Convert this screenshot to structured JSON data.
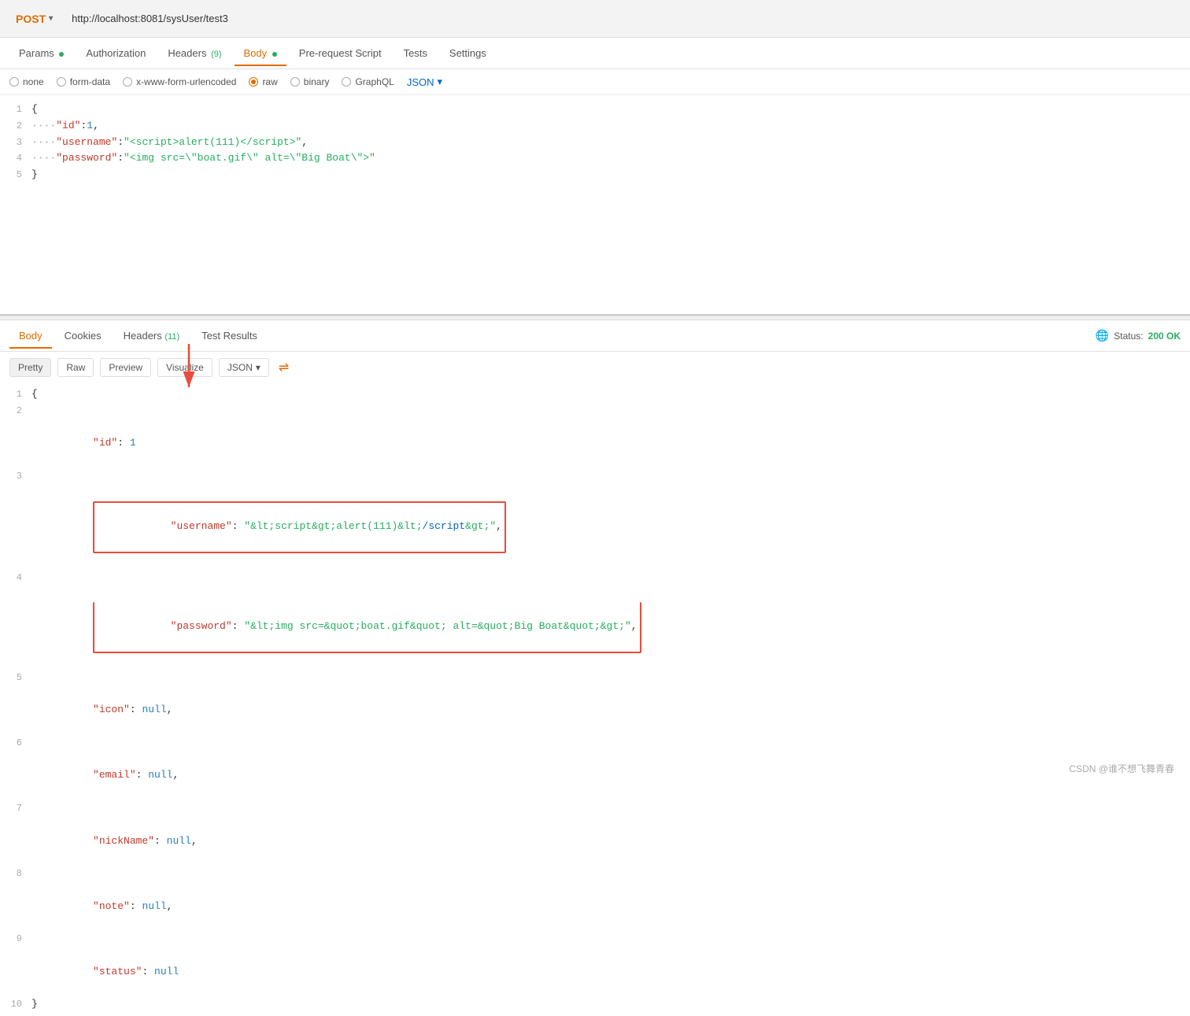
{
  "urlbar": {
    "method": "POST",
    "url": "http://localhost:8081/sysUser/test3",
    "chevron": "▾"
  },
  "tabs": [
    {
      "id": "params",
      "label": "Params",
      "dot": true,
      "active": false
    },
    {
      "id": "authorization",
      "label": "Authorization",
      "active": false
    },
    {
      "id": "headers",
      "label": "Headers",
      "badge": "(9)",
      "active": false
    },
    {
      "id": "body",
      "label": "Body",
      "dot": true,
      "active": true
    },
    {
      "id": "pre-request-script",
      "label": "Pre-request Script",
      "active": false
    },
    {
      "id": "tests",
      "label": "Tests",
      "active": false
    },
    {
      "id": "settings",
      "label": "Settings",
      "active": false
    }
  ],
  "body_types": [
    {
      "id": "none",
      "label": "none",
      "checked": false
    },
    {
      "id": "form-data",
      "label": "form-data",
      "checked": false
    },
    {
      "id": "x-www-form-urlencoded",
      "label": "x-www-form-urlencoded",
      "checked": false
    },
    {
      "id": "raw",
      "label": "raw",
      "checked": true
    },
    {
      "id": "binary",
      "label": "binary",
      "checked": false
    },
    {
      "id": "graphql",
      "label": "GraphQL",
      "checked": false
    }
  ],
  "json_dropdown": {
    "label": "JSON",
    "chevron": "▾"
  },
  "request_code": [
    {
      "num": "1",
      "content": "{"
    },
    {
      "num": "2",
      "content": "    \"id\":1,"
    },
    {
      "num": "3",
      "content": "    \"username\":\"<script>alert(111)<\\/script>\","
    },
    {
      "num": "4",
      "content": "    \"password\":\"<img src=\\\"boat.gif\\\" alt=\\\"Big Boat\\\">\""
    },
    {
      "num": "5",
      "content": "}"
    }
  ],
  "response": {
    "tabs": [
      {
        "id": "body",
        "label": "Body",
        "active": true
      },
      {
        "id": "cookies",
        "label": "Cookies",
        "active": false
      },
      {
        "id": "headers",
        "label": "Headers",
        "badge": "(11)",
        "active": false
      },
      {
        "id": "test-results",
        "label": "Test Results",
        "active": false
      }
    ],
    "status": "Status:",
    "status_code": "200 OK",
    "format_tabs": [
      "Pretty",
      "Raw",
      "Preview",
      "Visualize"
    ],
    "active_format": "Pretty",
    "format_dropdown": {
      "label": "JSON",
      "chevron": "▾"
    },
    "lines": [
      {
        "num": "1",
        "content": "{"
      },
      {
        "num": "2",
        "content": "    \"id\": 1"
      },
      {
        "num": "3",
        "content": "    \"username\": \"&amp;lt;script&amp;gt;alert(111)&amp;lt;/script&amp;gt;\",",
        "highlighted": true
      },
      {
        "num": "4",
        "content": "    \"password\": \"&amp;lt;img src=&amp;quot;boat.gif&amp;quot; alt=&amp;quot;Big Boat&amp;quot;&amp;gt;\",",
        "highlighted": true
      },
      {
        "num": "5",
        "content": "    \"icon\": null,"
      },
      {
        "num": "6",
        "content": "    \"email\": null,"
      },
      {
        "num": "7",
        "content": "    \"nickName\": null,"
      },
      {
        "num": "8",
        "content": "    \"note\": null,"
      },
      {
        "num": "9",
        "content": "    \"status\": null"
      },
      {
        "num": "10",
        "content": "}"
      }
    ]
  },
  "footer": {
    "text": "CSDN @谁不想飞舞青春"
  }
}
